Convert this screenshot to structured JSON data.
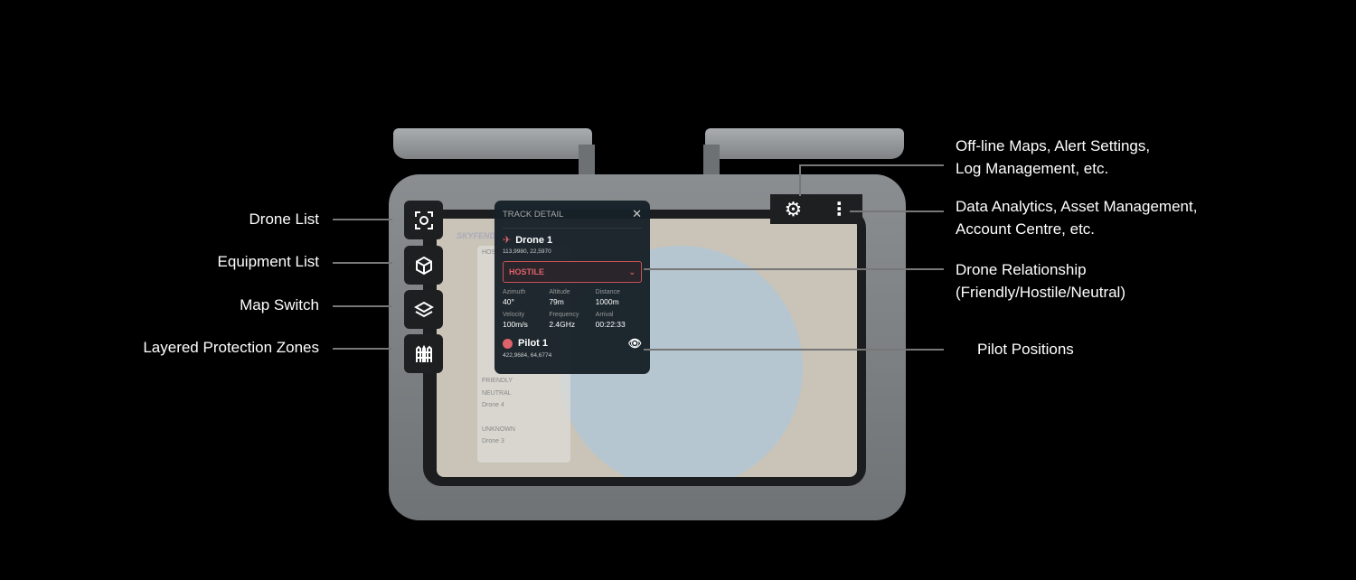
{
  "left_callouts": [
    "Drone List",
    "Equipment List",
    "Map Switch",
    "Layered Protection Zones"
  ],
  "right_callouts": [
    {
      "line1": "Off-line Maps, Alert Settings,",
      "line2": "Log Management, etc."
    },
    {
      "line1": "Data Analytics, Asset Management,",
      "line2": "Account Centre, etc."
    },
    {
      "line1": "Drone Relationship",
      "line2": "(Friendly/Hostile/Neutral)"
    },
    {
      "line1": "Pilot Positions",
      "line2": ""
    }
  ],
  "screen": {
    "brand": "SKYFEND",
    "groups": [
      "HOSTILE",
      "FRIENDLY",
      "NEUTRAL",
      "UNKNOWN"
    ],
    "neutral_item": "Drone 4",
    "unknown_item": "Drone 3"
  },
  "track_detail": {
    "title": "TRACK DETAIL",
    "drone_name": "Drone 1",
    "drone_coords": "113,9980, 22,5970",
    "relationship": "HOSTILE",
    "stats": [
      {
        "k": "Azimuth",
        "v": "40°"
      },
      {
        "k": "Altitude",
        "v": "79m"
      },
      {
        "k": "Distance",
        "v": "1000m"
      },
      {
        "k": "Velocity",
        "v": "100m/s"
      },
      {
        "k": "Frequency",
        "v": "2.4GHz"
      },
      {
        "k": "Arrival",
        "v": "00:22:33"
      }
    ],
    "pilot_name": "Pilot 1",
    "pilot_coords": "422,9684, 64,6774"
  },
  "colors": {
    "hostile": "#e0626a",
    "panel": "#162028"
  }
}
